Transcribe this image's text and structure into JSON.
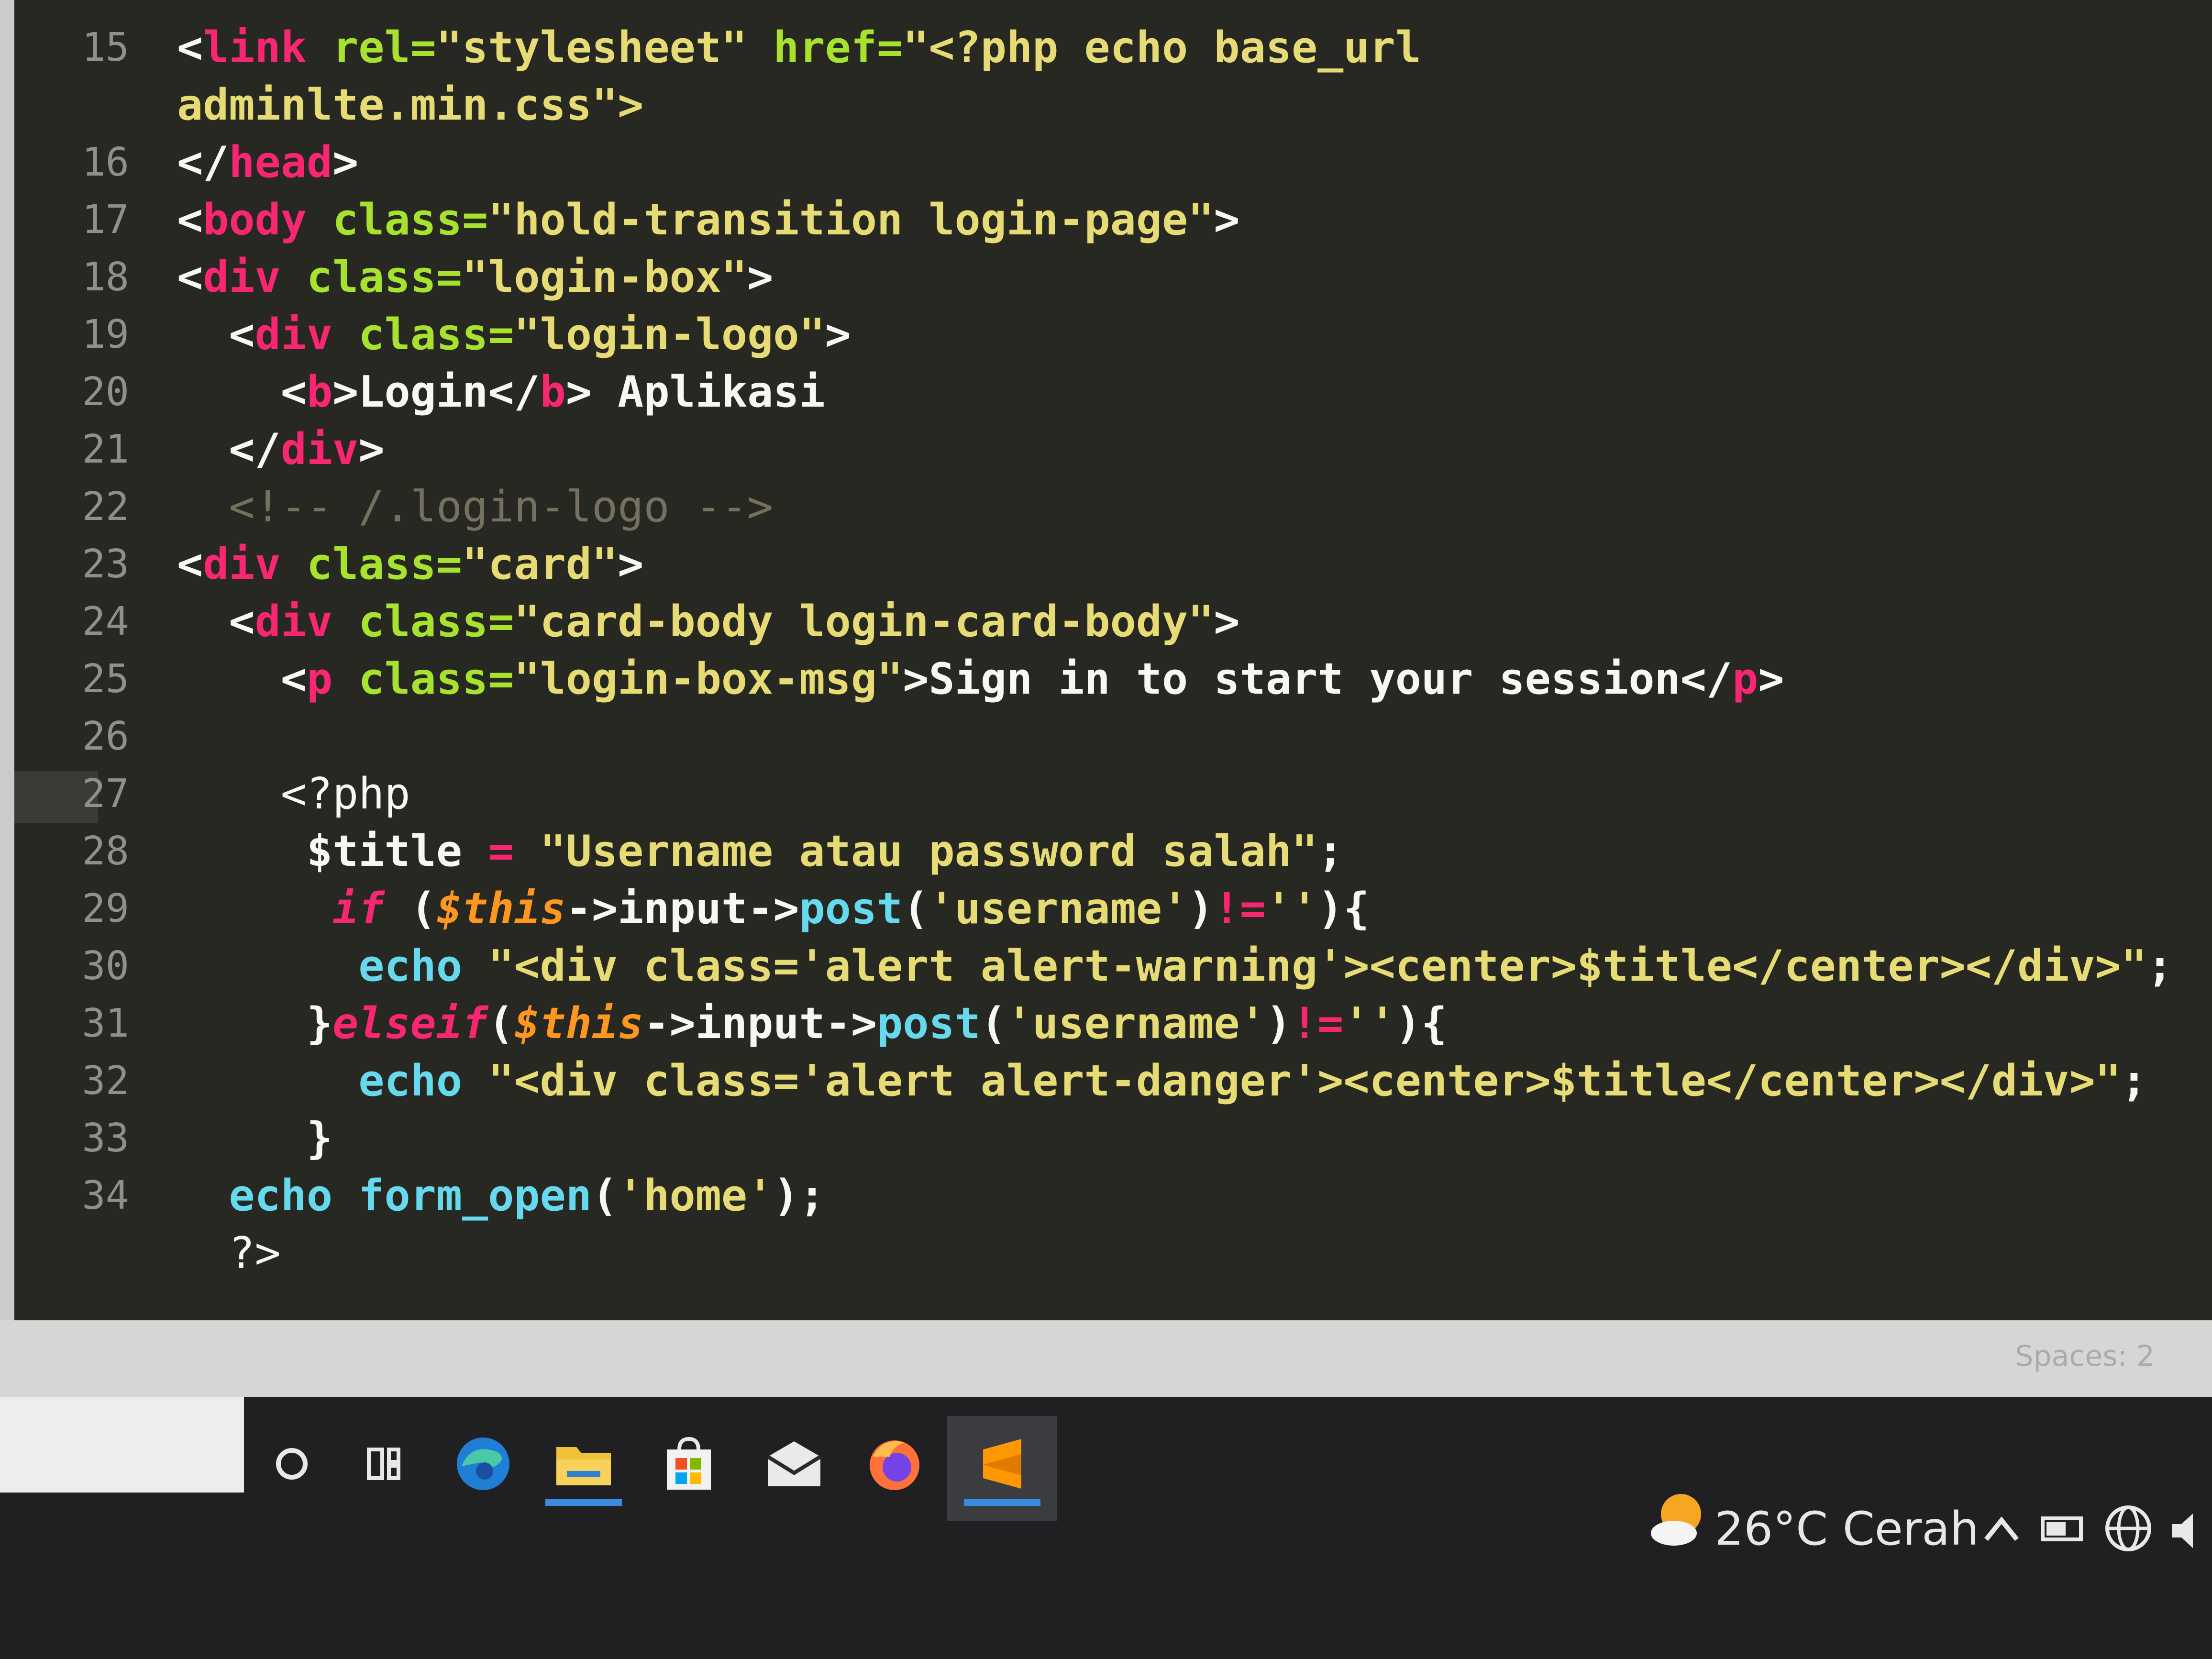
{
  "editor": {
    "lines": [
      {
        "num": "15",
        "segments": [
          {
            "t": "<",
            "c": "text"
          },
          {
            "t": "link",
            "c": "tag"
          },
          {
            "t": " rel=",
            "c": "attr"
          },
          {
            "t": "\"stylesheet\"",
            "c": "str"
          },
          {
            "t": " href=",
            "c": "attr"
          },
          {
            "t": "\"<?php echo base_url",
            "c": "str"
          }
        ]
      },
      {
        "num": "",
        "segments": [
          {
            "t": "adminlte.min.css\">",
            "c": "str"
          }
        ]
      },
      {
        "num": "16",
        "segments": [
          {
            "t": "</",
            "c": "text"
          },
          {
            "t": "head",
            "c": "tag"
          },
          {
            "t": ">",
            "c": "text"
          }
        ]
      },
      {
        "num": "17",
        "segments": [
          {
            "t": "<",
            "c": "text"
          },
          {
            "t": "body",
            "c": "tag"
          },
          {
            "t": " class=",
            "c": "attr"
          },
          {
            "t": "\"hold-transition login-page\"",
            "c": "str"
          },
          {
            "t": ">",
            "c": "text"
          }
        ]
      },
      {
        "num": "18",
        "segments": [
          {
            "t": "<",
            "c": "text"
          },
          {
            "t": "div",
            "c": "tag"
          },
          {
            "t": " class=",
            "c": "attr"
          },
          {
            "t": "\"login-box\"",
            "c": "str"
          },
          {
            "t": ">",
            "c": "text"
          }
        ]
      },
      {
        "num": "19",
        "segments": [
          {
            "t": "  <",
            "c": "text"
          },
          {
            "t": "div",
            "c": "tag"
          },
          {
            "t": " class=",
            "c": "attr"
          },
          {
            "t": "\"login-logo\"",
            "c": "str"
          },
          {
            "t": ">",
            "c": "text"
          }
        ]
      },
      {
        "num": "20",
        "segments": [
          {
            "t": "    <",
            "c": "text"
          },
          {
            "t": "b",
            "c": "tag"
          },
          {
            "t": ">Login</",
            "c": "text"
          },
          {
            "t": "b",
            "c": "tag"
          },
          {
            "t": "> Aplikasi",
            "c": "text"
          }
        ]
      },
      {
        "num": "21",
        "segments": [
          {
            "t": "  </",
            "c": "text"
          },
          {
            "t": "div",
            "c": "tag"
          },
          {
            "t": ">",
            "c": "text"
          }
        ]
      },
      {
        "num": "22",
        "segments": [
          {
            "t": "  <!-- /.login-logo -->",
            "c": "cmt"
          }
        ]
      },
      {
        "num": "23",
        "segments": [
          {
            "t": "<",
            "c": "text"
          },
          {
            "t": "div",
            "c": "tag"
          },
          {
            "t": " class=",
            "c": "attr"
          },
          {
            "t": "\"card\"",
            "c": "str"
          },
          {
            "t": ">",
            "c": "text"
          }
        ]
      },
      {
        "num": "24",
        "segments": [
          {
            "t": "  <",
            "c": "text"
          },
          {
            "t": "div",
            "c": "tag"
          },
          {
            "t": " class=",
            "c": "attr"
          },
          {
            "t": "\"card-body login-card-body\"",
            "c": "str"
          },
          {
            "t": ">",
            "c": "text"
          }
        ]
      },
      {
        "num": "25",
        "segments": [
          {
            "t": "    <",
            "c": "text"
          },
          {
            "t": "p",
            "c": "tag"
          },
          {
            "t": " class=",
            "c": "attr"
          },
          {
            "t": "\"login-box-msg\"",
            "c": "str"
          },
          {
            "t": ">Sign in to start your session</",
            "c": "text"
          },
          {
            "t": "p",
            "c": "tag"
          },
          {
            "t": ">",
            "c": "text"
          }
        ]
      },
      {
        "num": "26",
        "segments": []
      },
      {
        "num": "27",
        "segments": [
          {
            "t": "    <?php",
            "c": "php"
          }
        ]
      },
      {
        "num": "28",
        "segments": [
          {
            "t": "     $title ",
            "c": "text"
          },
          {
            "t": "=",
            "c": "op"
          },
          {
            "t": " \"Username atau password salah\"",
            "c": "str"
          },
          {
            "t": ";",
            "c": "text"
          }
        ]
      },
      {
        "num": "29",
        "segments": [
          {
            "t": "      ",
            "c": "text"
          },
          {
            "t": "if",
            "c": "kw"
          },
          {
            "t": " (",
            "c": "text"
          },
          {
            "t": "$this",
            "c": "var"
          },
          {
            "t": "->input->",
            "c": "text"
          },
          {
            "t": "post",
            "c": "func"
          },
          {
            "t": "(",
            "c": "text"
          },
          {
            "t": "'username'",
            "c": "str"
          },
          {
            "t": ")",
            "c": "text"
          },
          {
            "t": "!=",
            "c": "op"
          },
          {
            "t": "''",
            "c": "str"
          },
          {
            "t": "){",
            "c": "text"
          }
        ]
      },
      {
        "num": "30",
        "segments": [
          {
            "t": "       ",
            "c": "text"
          },
          {
            "t": "echo",
            "c": "func"
          },
          {
            "t": " \"<div class='alert alert-warning'><center>$title</center></div>\"",
            "c": "str"
          },
          {
            "t": ";",
            "c": "text"
          }
        ]
      },
      {
        "num": "31",
        "segments": [
          {
            "t": "     }",
            "c": "text"
          },
          {
            "t": "elseif",
            "c": "kw"
          },
          {
            "t": "(",
            "c": "text"
          },
          {
            "t": "$this",
            "c": "var"
          },
          {
            "t": "->input->",
            "c": "text"
          },
          {
            "t": "post",
            "c": "func"
          },
          {
            "t": "(",
            "c": "text"
          },
          {
            "t": "'username'",
            "c": "str"
          },
          {
            "t": ")",
            "c": "text"
          },
          {
            "t": "!=",
            "c": "op"
          },
          {
            "t": "''",
            "c": "str"
          },
          {
            "t": "){",
            "c": "text"
          }
        ]
      },
      {
        "num": "32",
        "segments": [
          {
            "t": "       ",
            "c": "text"
          },
          {
            "t": "echo",
            "c": "func"
          },
          {
            "t": " \"<div class='alert alert-danger'><center>$title</center></div>\"",
            "c": "str"
          },
          {
            "t": ";",
            "c": "text"
          }
        ]
      },
      {
        "num": "33",
        "segments": [
          {
            "t": "     }",
            "c": "text"
          }
        ]
      },
      {
        "num": "34",
        "segments": [
          {
            "t": "  ",
            "c": "text"
          },
          {
            "t": "echo",
            "c": "func"
          },
          {
            "t": " ",
            "c": "text"
          },
          {
            "t": "form_open",
            "c": "func"
          },
          {
            "t": "(",
            "c": "text"
          },
          {
            "t": "'home'",
            "c": "str"
          },
          {
            "t": ");",
            "c": "text"
          }
        ]
      },
      {
        "num": "",
        "segments": [
          {
            "t": "  ?>",
            "c": "php"
          }
        ]
      }
    ]
  },
  "status_bar": {
    "spaces_label": "Spaces: 2"
  },
  "taskbar": {
    "icons": [
      {
        "name": "search-circle-icon"
      },
      {
        "name": "task-view-icon"
      },
      {
        "name": "edge-browser-icon"
      },
      {
        "name": "file-explorer-icon"
      },
      {
        "name": "store-icon"
      },
      {
        "name": "mail-icon"
      },
      {
        "name": "firefox-icon"
      },
      {
        "name": "sublime-text-icon"
      }
    ],
    "weather": {
      "text": "26°C Cerah"
    },
    "colors": {
      "accent": "#3b8be0",
      "weather_sun": "#f5a623"
    }
  }
}
